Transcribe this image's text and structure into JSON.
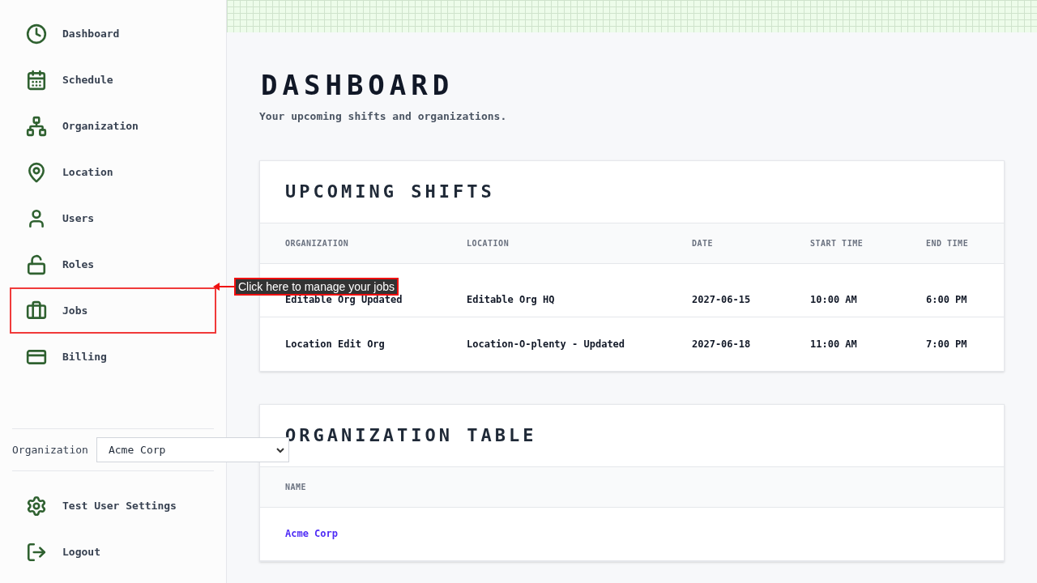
{
  "sidebar": {
    "items": [
      {
        "label": "Dashboard",
        "highlighted": false
      },
      {
        "label": "Schedule",
        "highlighted": false
      },
      {
        "label": "Organization",
        "highlighted": false
      },
      {
        "label": "Location",
        "highlighted": false
      },
      {
        "label": "Users",
        "highlighted": false
      },
      {
        "label": "Roles",
        "highlighted": false
      },
      {
        "label": "Jobs",
        "highlighted": true
      },
      {
        "label": "Billing",
        "highlighted": false
      }
    ],
    "organization": {
      "label": "Organization",
      "value": "Acme Corp"
    },
    "footer_items": [
      {
        "label": "Test User Settings"
      },
      {
        "label": "Logout"
      }
    ]
  },
  "annotation": {
    "text": "Click here to manage your jobs"
  },
  "page": {
    "title": "DASHBOARD",
    "subtitle": "Your upcoming shifts and organizations."
  },
  "shifts": {
    "title": "UPCOMING SHIFTS",
    "columns": [
      "ORGANIZATION",
      "LOCATION",
      "DATE",
      "START TIME",
      "END TIME"
    ],
    "rows": [
      [
        "Editable Org Updated",
        "Editable Org HQ",
        "2027-06-15",
        "10:00 AM",
        "6:00 PM"
      ],
      [
        "Location Edit Org",
        "Location-O-plenty - Updated",
        "2027-06-18",
        "11:00 AM",
        "7:00 PM"
      ]
    ]
  },
  "organizations": {
    "title": "ORGANIZATION TABLE",
    "columns": [
      "NAME"
    ],
    "rows": [
      {
        "name": "Acme Corp"
      }
    ]
  }
}
